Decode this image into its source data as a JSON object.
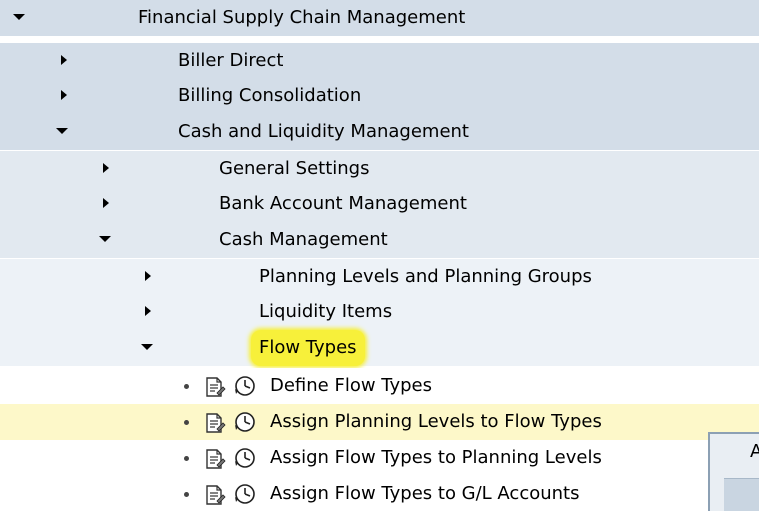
{
  "tree": {
    "root": {
      "label": "Financial Supply Chain Management",
      "state": "expanded"
    },
    "level1": [
      {
        "label": "Biller Direct",
        "state": "collapsed"
      },
      {
        "label": "Billing Consolidation",
        "state": "collapsed"
      },
      {
        "label": "Cash and Liquidity Management",
        "state": "expanded"
      }
    ],
    "level2": [
      {
        "label": "General Settings",
        "state": "collapsed"
      },
      {
        "label": "Bank Account Management",
        "state": "collapsed"
      },
      {
        "label": "Cash Management",
        "state": "expanded"
      }
    ],
    "level3": [
      {
        "label": "Planning Levels and Planning Groups",
        "state": "collapsed"
      },
      {
        "label": "Liquidity Items",
        "state": "collapsed"
      },
      {
        "label": "Flow Types",
        "state": "expanded",
        "highlighted": true
      }
    ],
    "activities": [
      {
        "label": "Define Flow Types",
        "doc_icon": "documentation-icon",
        "exec_icon": "execute-clock-icon"
      },
      {
        "label": "Assign Planning Levels to Flow Types",
        "doc_icon": "documentation-icon",
        "exec_icon": "execute-clock-icon",
        "hovered": true
      },
      {
        "label": "Assign Flow Types to Planning Levels",
        "doc_icon": "documentation-icon",
        "exec_icon": "execute-clock-icon"
      },
      {
        "label": "Assign Flow Types to G/L Accounts",
        "doc_icon": "documentation-icon",
        "exec_icon": "execute-clock-icon"
      }
    ]
  },
  "side_panel": {
    "label": "A"
  },
  "colors": {
    "band_level0": "#d3dde8",
    "band_level1": "#e2e9f0",
    "band_level2": "#edf2f7",
    "highlight": "#f7f03a",
    "hover_row": "#fdf8c9"
  }
}
